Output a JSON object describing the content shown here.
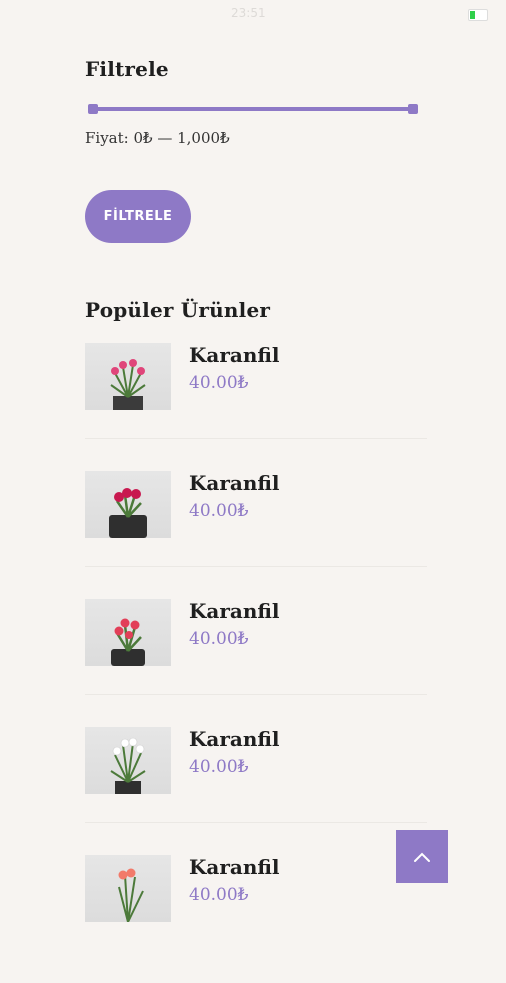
{
  "status_bar": {
    "time": "23:51"
  },
  "filter": {
    "title": "Filtrele",
    "price_label": "Fiyat:",
    "price_value": "0₺ — 1,000₺",
    "button_label": "FİLTRELE",
    "accent_color": "#8e79c6"
  },
  "popular": {
    "title": "Popüler Ürünler",
    "products": [
      {
        "name": "Karanfil",
        "price": "40.00₺",
        "flower_color": "#e0457a"
      },
      {
        "name": "Karanfil",
        "price": "40.00₺",
        "flower_color": "#c8184f"
      },
      {
        "name": "Karanfil",
        "price": "40.00₺",
        "flower_color": "#e23f58"
      },
      {
        "name": "Karanfil",
        "price": "40.00₺",
        "flower_color": "#ffffff"
      },
      {
        "name": "Karanfil",
        "price": "40.00₺",
        "flower_color": "#f27a6a"
      }
    ]
  },
  "icons": {
    "to_top": "chevron-up-icon"
  }
}
